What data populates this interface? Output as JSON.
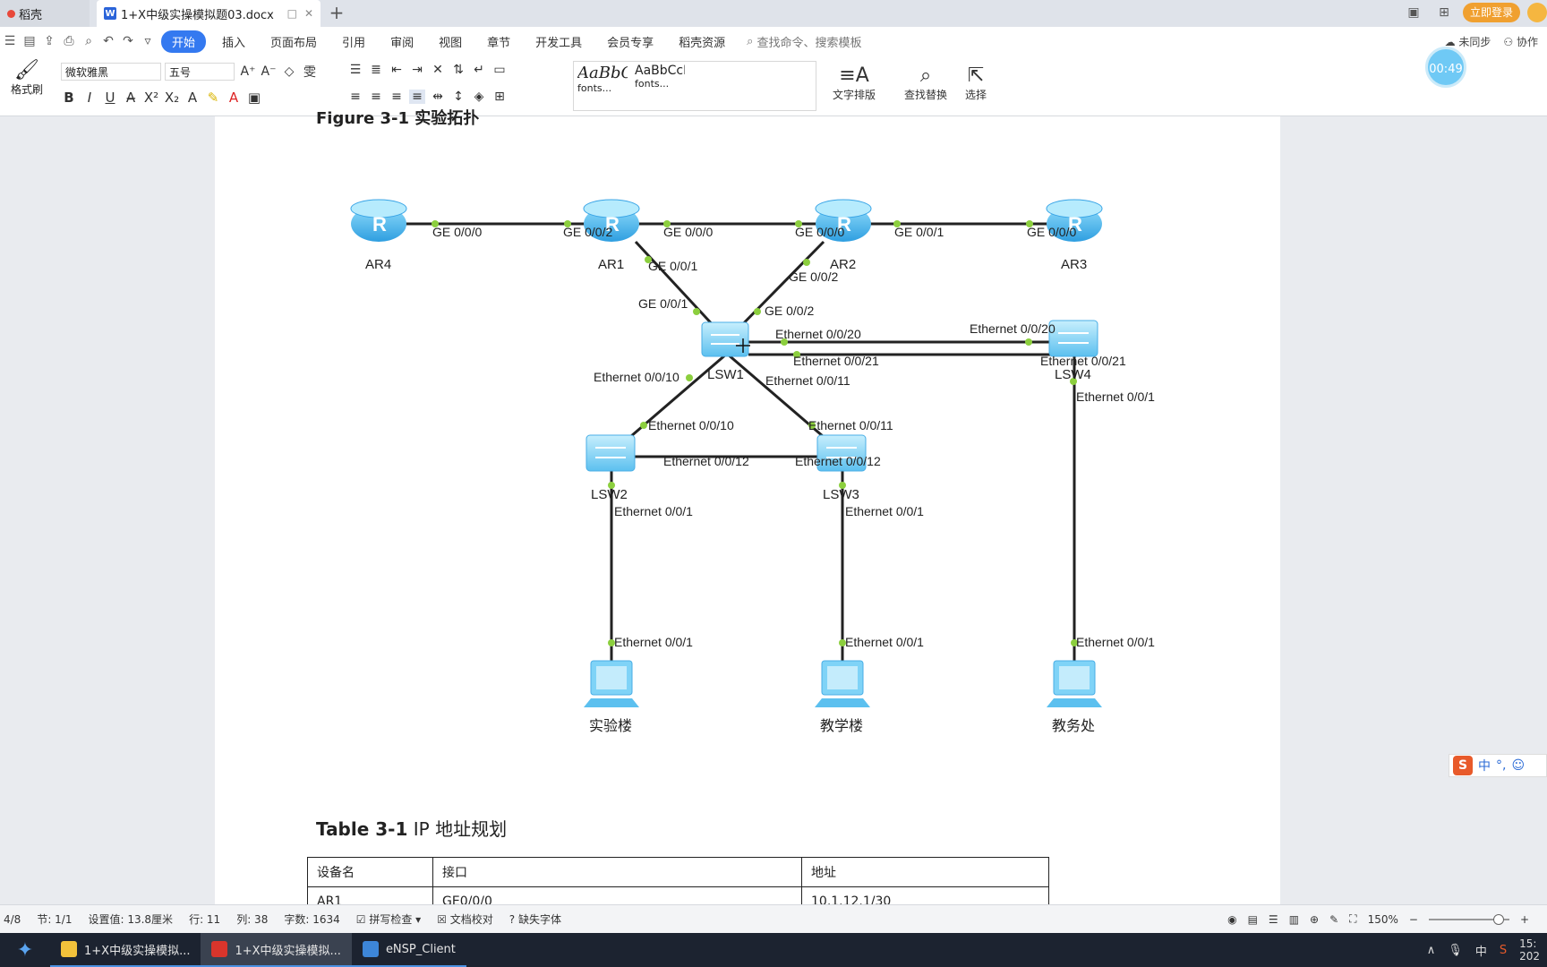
{
  "titlebar": {
    "tab_docer": "稻壳",
    "tab_doc": "1+X中级实操模拟题03.docx",
    "login": "立即登录"
  },
  "menubar": {
    "items": [
      "开始",
      "插入",
      "页面布局",
      "引用",
      "审阅",
      "视图",
      "章节",
      "开发工具",
      "会员专享",
      "稻壳资源"
    ],
    "search_placeholder": "查找命令、搜索模板",
    "right_sync": "未同步",
    "right_collab": "协作"
  },
  "ribbon": {
    "format_painter": "格式刷",
    "font_name": "微软雅黑",
    "font_size": "五号",
    "style1_sample": "AaBbC",
    "style1_name": "fonts...",
    "style2_sample": "AaBbCcDc",
    "style2_name": "fonts...",
    "text_layout": "文字排版",
    "find_replace": "查找替换",
    "select": "选择"
  },
  "timer": "00:49",
  "document": {
    "figure_caption": "Figure 3-1  实验拓扑",
    "table_title_bold": "Table 3-1",
    "table_title_rest": " IP 地址规划",
    "table_headers": [
      "设备名",
      "接口",
      "地址"
    ],
    "table_rows": [
      [
        "AR1",
        "GE0/0/0",
        "10.1.12.1/30"
      ]
    ]
  },
  "topology": {
    "devices": {
      "AR4": "AR4",
      "AR1": "AR1",
      "AR2": "AR2",
      "AR3": "AR3",
      "LSW1": "LSW1",
      "LSW2": "LSW2",
      "LSW3": "LSW3",
      "LSW4": "LSW4",
      "PC1": "实验楼",
      "PC2": "教学楼",
      "PC3": "教务处"
    },
    "ports": {
      "ar4_ar1_a": "GE 0/0/0",
      "ar4_ar1_b": "GE 0/0/2",
      "ar1_ar2_a": "GE 0/0/0",
      "ar1_ar2_b": "GE 0/0/0",
      "ar2_ar3_a": "GE 0/0/1",
      "ar2_ar3_b": "GE 0/0/0",
      "ar1_lsw1_a": "GE 0/0/1",
      "ar1_lsw1_b": "GE 0/0/1",
      "ar2_lsw1_a": "GE 0/0/2",
      "ar2_lsw1_b": "GE 0/0/2",
      "lsw1_lsw4_20a": "Ethernet 0/0/20",
      "lsw1_lsw4_20b": "Ethernet 0/0/20",
      "lsw1_lsw4_21a": "Ethernet 0/0/21",
      "lsw1_lsw4_21b": "Ethernet 0/0/21",
      "lsw1_lsw2_a": "Ethernet 0/0/10",
      "lsw1_lsw2_b": "Ethernet 0/0/10",
      "lsw1_lsw3_a": "Ethernet 0/0/11",
      "lsw1_lsw3_b": "Ethernet 0/0/11",
      "lsw2_lsw3_a": "Ethernet 0/0/12",
      "lsw2_lsw3_b": "Ethernet 0/0/12",
      "lsw4_pc3": "Ethernet 0/0/1",
      "lsw2_pc1": "Ethernet 0/0/1",
      "lsw3_pc2": "Ethernet 0/0/1",
      "pc1_port": "Ethernet 0/0/1",
      "pc2_port": "Ethernet 0/0/1",
      "pc3_port": "Ethernet 0/0/1"
    }
  },
  "statusbar": {
    "page": "4/8",
    "section": "节: 1/1",
    "setting": "设置值: 13.8厘米",
    "row": "行: 11",
    "col": "列: 38",
    "words": "字数: 1634",
    "spell": "拼写检查",
    "proof": "文档校对",
    "missing_font": "缺失字体",
    "zoom": "150%"
  },
  "taskbar": {
    "item1": "1+X中级实操模拟...",
    "item2": "1+X中级实操模拟...",
    "item3": "eNSP_Client",
    "ime": "中",
    "clock_top": "15:",
    "clock_bottom": "202"
  },
  "colors": {
    "accent": "#3479f0",
    "router": "#4bb6ee",
    "link_dot": "#8ccf3e"
  }
}
